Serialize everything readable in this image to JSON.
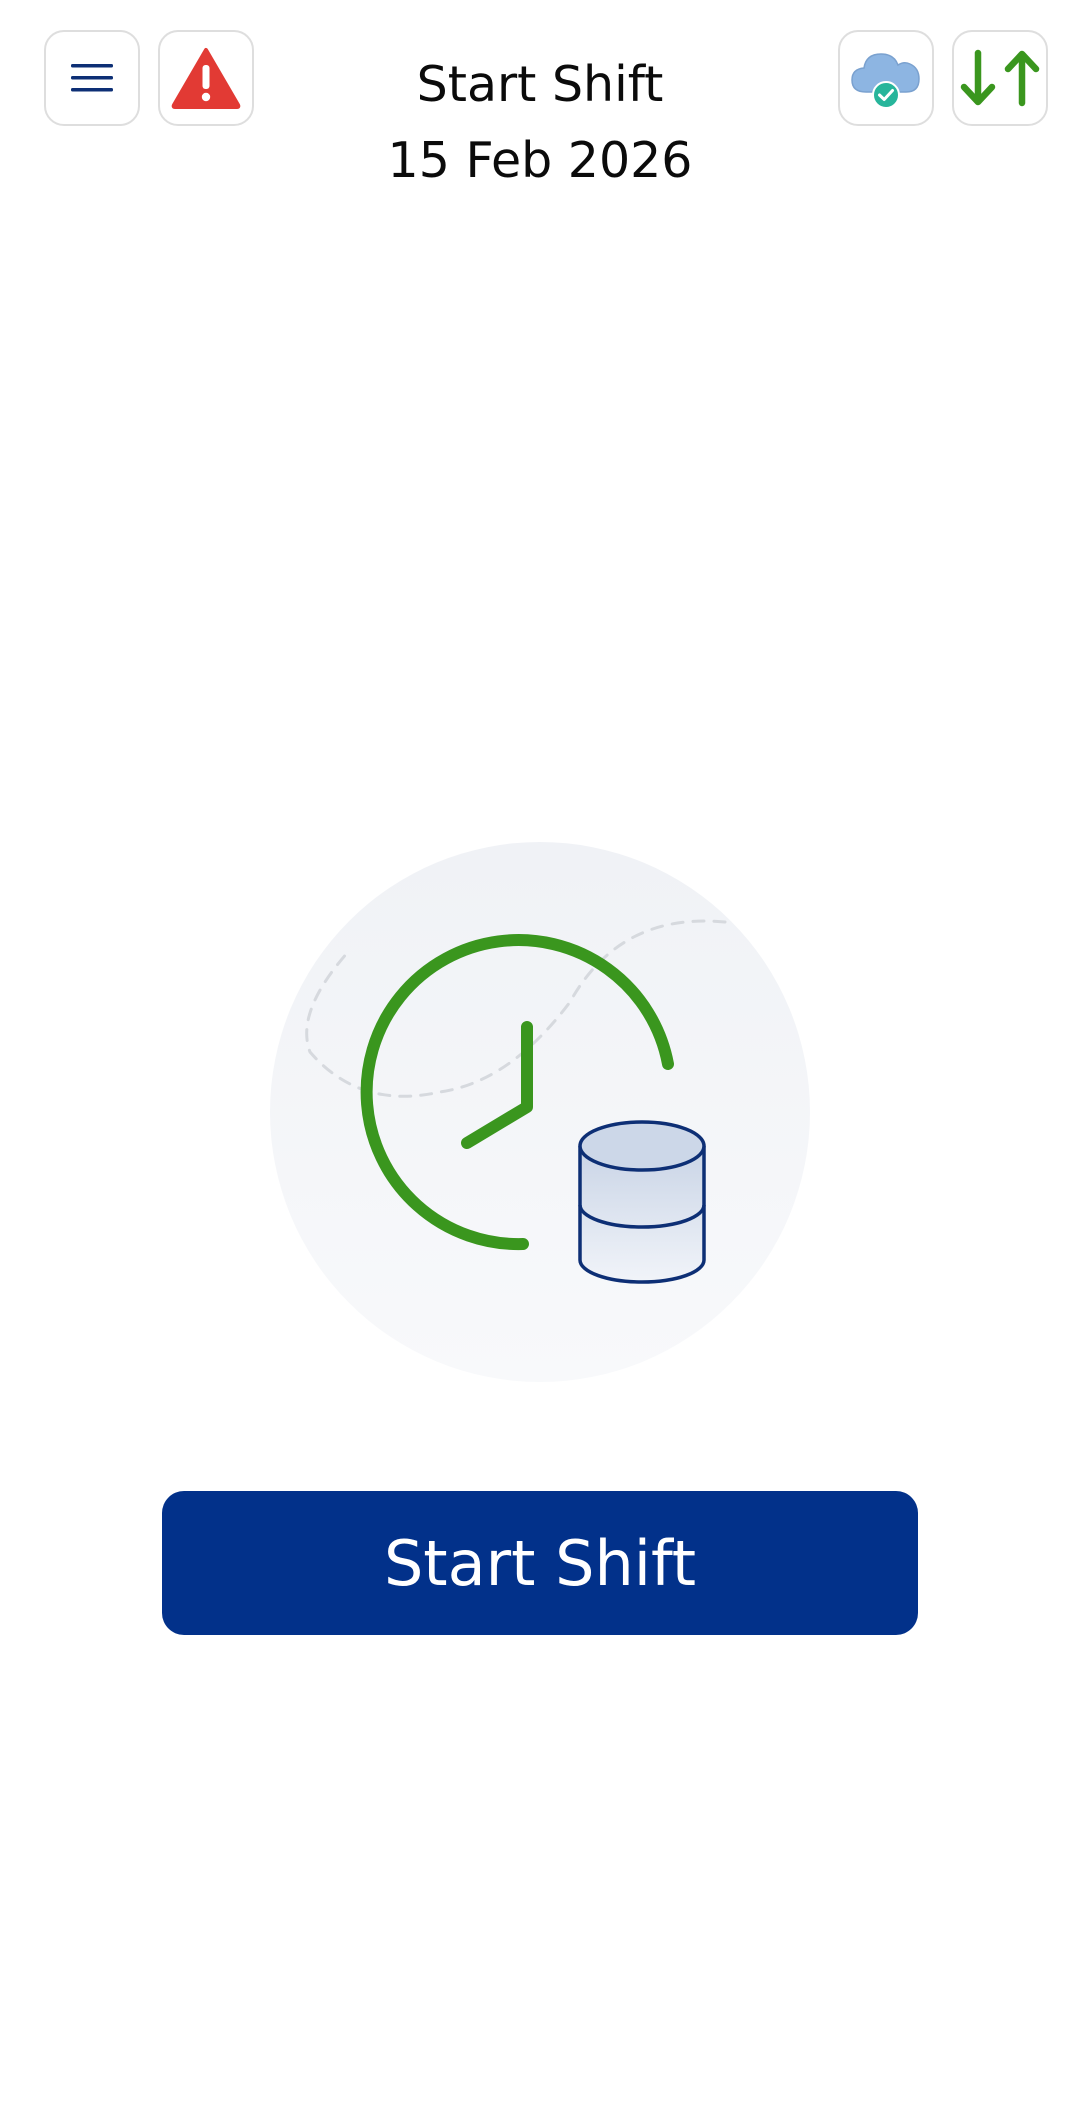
{
  "header": {
    "title": "Start Shift",
    "date": "15 Feb 2026"
  },
  "toolbar": {
    "menu_icon": "hamburger-menu-icon",
    "alert_icon": "warning-triangle-icon",
    "cloud_icon": "cloud-synced-check-icon",
    "sync_icon": "download-upload-arrows-icon"
  },
  "main": {
    "illustration_icon": "clock-database-icon",
    "start_button_label": "Start Shift"
  },
  "colors": {
    "primary": "#02318a",
    "accent_green": "#3a961e",
    "alert_red": "#e23a34",
    "cloud_blue": "#8db5e2",
    "check_teal": "#27b59b"
  }
}
